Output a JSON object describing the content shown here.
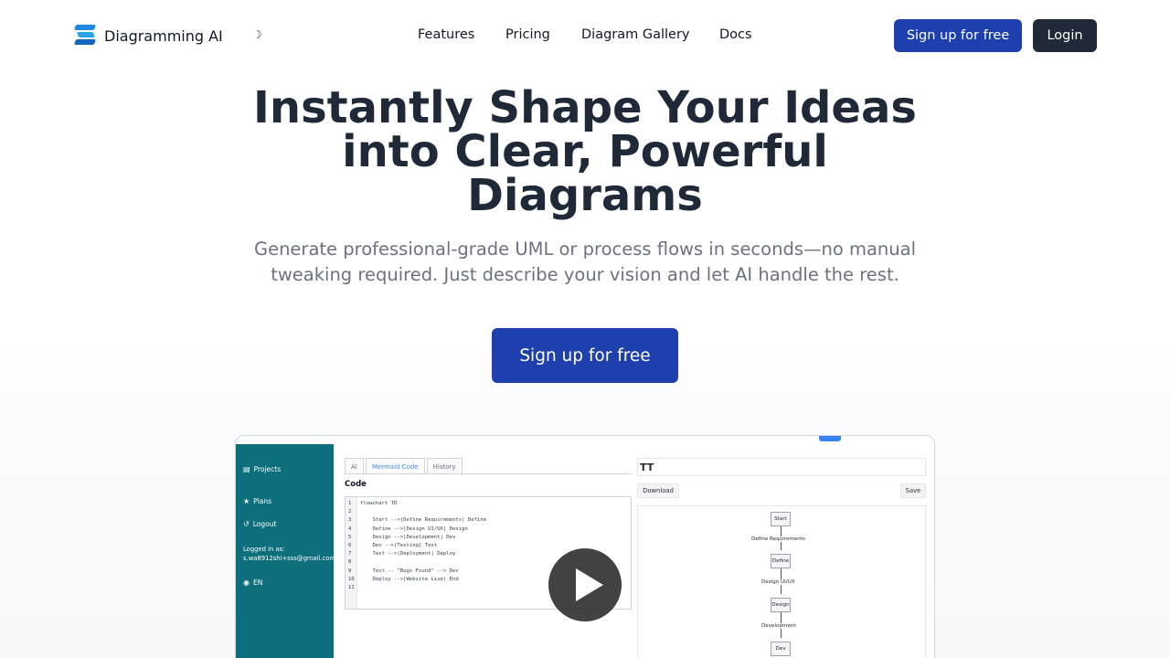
{
  "nav": {
    "brand": "Diagramming AI",
    "theme_toggle": "☽",
    "links": [
      "Features",
      "Pricing",
      "Diagram Gallery",
      "Docs"
    ],
    "signup_label": "Sign up for free",
    "login_label": "Login"
  },
  "hero": {
    "title": "Instantly Shape Your Ideas into Clear, Powerful Diagrams",
    "subtitle": "Generate professional-grade UML or process flows in seconds—no manual tweaking required. Just describe your vision and let AI handle the rest.",
    "cta_label": "Sign up for free"
  },
  "preview": {
    "sidebar": {
      "projects": "Projects",
      "plans": "Plans",
      "logout": "Logout",
      "logged_in_label": "Logged in as:",
      "email": "s.wa8912shi+sss@gmail.com",
      "language": "EN"
    },
    "tabs": [
      "AI",
      "Mermaid Code",
      "History"
    ],
    "code_label": "Code",
    "code_lines": [
      "flowchart TD",
      "",
      "    Start -->|Define Requirements| Define",
      "    Define -->|Design UI/UX| Design",
      "    Design -->|Development| Dev",
      "    Dev -->|Testing| Test",
      "    Test -->|Deployment| Deploy",
      "",
      "    Test -- \"Bugs Found\" --> Dev",
      "    Deploy -->|Website Live| End",
      ""
    ],
    "line_numbers": [
      "1",
      "2",
      "3",
      "4",
      "5",
      "6",
      "7",
      "8",
      "9",
      "10",
      "11"
    ],
    "title_value": "TT",
    "download_label": "Download",
    "save_label": "Save",
    "flow": {
      "nodes": [
        "Start",
        "Define",
        "Design",
        "Dev"
      ],
      "edges": [
        "Define Requirements",
        "Design UI/UX",
        "Development"
      ]
    }
  },
  "colors": {
    "primary": "#1e40af",
    "dark": "#1f2937",
    "sidebar": "#0d6e7c"
  }
}
